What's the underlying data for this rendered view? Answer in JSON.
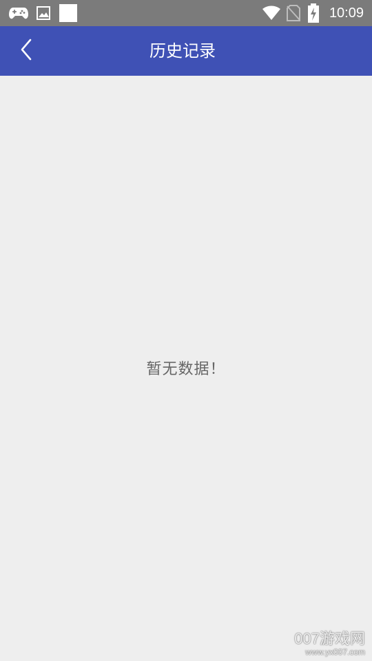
{
  "status_bar": {
    "time": "10:09",
    "icons": [
      "gamepad-icon",
      "image-icon",
      "blank-square-icon",
      "wifi-icon",
      "no-sim-icon",
      "battery-charging-icon"
    ],
    "background": "#7b7b7b"
  },
  "app_bar": {
    "title": "历史记录",
    "back_icon": "chevron-left-icon",
    "background": "#3f51b5"
  },
  "content": {
    "empty_message": "暂无数据！",
    "background": "#eeeeee"
  },
  "watermark": {
    "title": "007游戏网",
    "url": "www.yx007.com"
  }
}
